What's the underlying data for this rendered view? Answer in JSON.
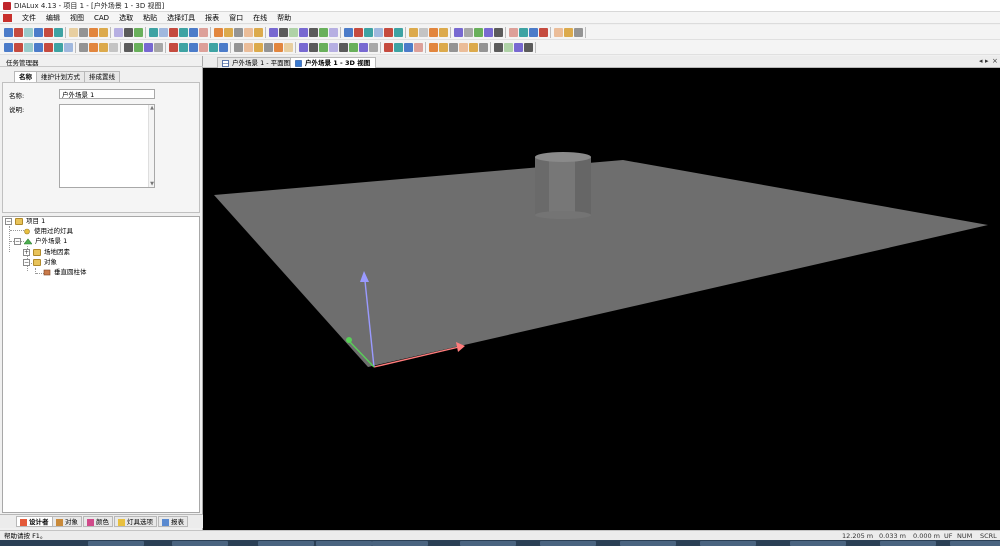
{
  "window": {
    "title": "DIALux 4.13 - 项目 1 - [户外场景 1 - 3D 视图]"
  },
  "menu": {
    "items": [
      "文件",
      "编辑",
      "视图",
      "CAD",
      "选取",
      "粘贴",
      "选择灯具",
      "报表",
      "窗口",
      "在线",
      "帮助"
    ]
  },
  "view_tabs": [
    {
      "label": "户外场景 1 - 平面图",
      "active": false
    },
    {
      "label": "户外场景 1 - 3D 视图",
      "active": true
    }
  ],
  "tab_controls": {
    "left": "◂",
    "right": "▸",
    "close": "×"
  },
  "left_panel": {
    "header": "任务管理器",
    "tabs": [
      "名称",
      "维护计划方式",
      "排成置线"
    ],
    "props": {
      "name_label": "名称:",
      "name_value": "户外场景 1",
      "desc_label": "说明:",
      "desc_value": ""
    },
    "tree": {
      "project": "项目 1",
      "used_luminaires": "使用过的灯具",
      "scene": "户外场景 1",
      "site_elements": "场地因素",
      "objects": "对象",
      "cylinder": "垂直圆柱体"
    },
    "bottom_tabs": [
      "设计者",
      "对象",
      "颜色",
      "灯具选项",
      "报表"
    ]
  },
  "statusbar": {
    "help": "帮助请按 F1。",
    "cells": [
      "12.205 m",
      "0.033 m",
      "0.000 m",
      "UF",
      "NUM",
      "SCRL"
    ]
  },
  "colors": {
    "ground": "#6e6e6e",
    "cylinder": "#777777",
    "axis_x": "#ff7c7c",
    "axis_y": "#9a9aff",
    "axis_z": "#58d058"
  },
  "icons": [
    "folder-icon",
    "luminaire-icon",
    "scene-icon",
    "object-icon",
    "cylinder-icon"
  ]
}
